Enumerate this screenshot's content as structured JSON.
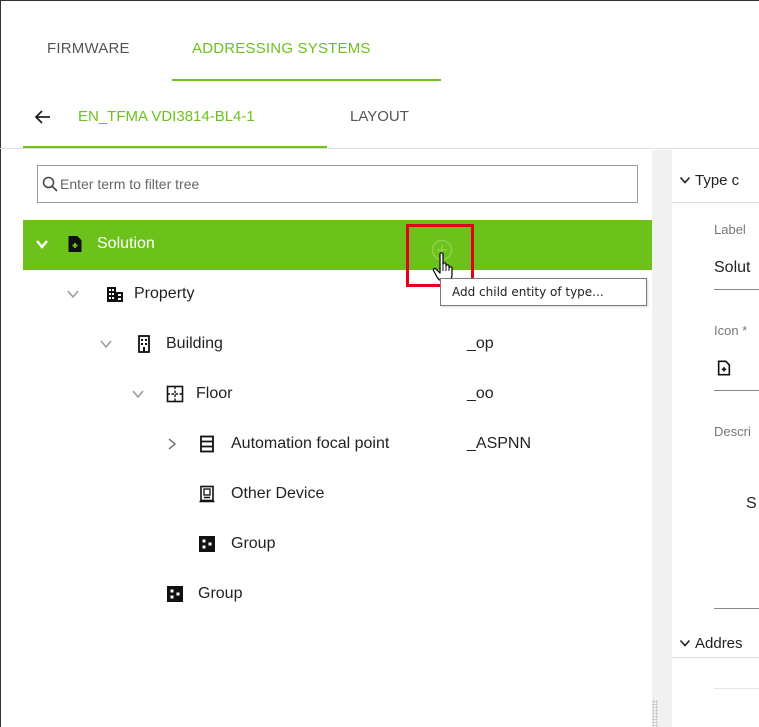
{
  "top_tabs": {
    "firmware": "FIRMWARE",
    "addressing": "ADDRESSING SYSTEMS"
  },
  "sub_tabs": {
    "project": "EN_TFMA VDI3814-BL4-1",
    "layout": "LAYOUT"
  },
  "search": {
    "placeholder": "Enter term to filter tree",
    "value": ""
  },
  "tree": {
    "solution": {
      "label": "Solution",
      "code": "",
      "expanded": true,
      "selected": true,
      "icon": "solution-icon"
    },
    "property": {
      "label": "Property",
      "code": "",
      "expanded": true,
      "icon": "property-icon"
    },
    "building": {
      "label": "Building",
      "code": "_op",
      "expanded": true,
      "icon": "building-icon"
    },
    "floor": {
      "label": "Floor",
      "code": "_oo",
      "expanded": true,
      "icon": "floor-icon"
    },
    "automation": {
      "label": "Automation focal point",
      "code": "_ASPNN",
      "expanded": false,
      "icon": "automation-focal-point-icon"
    },
    "other_device": {
      "label": "Other Device",
      "code": "",
      "icon": "other-device-icon"
    },
    "group_floor": {
      "label": "Group",
      "code": "",
      "icon": "group-icon"
    },
    "group_property": {
      "label": "Group",
      "code": "",
      "icon": "group-icon"
    }
  },
  "add_child": {
    "icon": "add-circle-icon",
    "tooltip": "Add child entity of type..."
  },
  "details": {
    "type_header": "Type c",
    "label_label": "Label",
    "label_value": "Solut",
    "icon_label": "Icon *",
    "icon_name": "solution-icon",
    "description_label": "Descri",
    "description_value": "S",
    "addressing_header": "Addres"
  },
  "colors": {
    "accent": "#6cc21a",
    "highlight_box": "#e3001b"
  }
}
